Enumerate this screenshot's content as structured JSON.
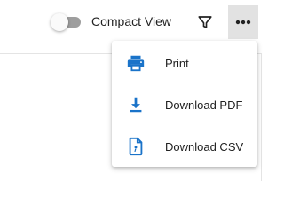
{
  "toolbar": {
    "compact_view": {
      "label": "Compact View",
      "enabled": false
    },
    "filter_icon": "filter-icon",
    "more_icon": "more-horizontal-icon"
  },
  "menu": {
    "items": [
      {
        "label": "Print",
        "icon": "print-icon"
      },
      {
        "label": "Download PDF",
        "icon": "download-icon"
      },
      {
        "label": "Download CSV",
        "icon": "csv-file-icon"
      }
    ]
  },
  "colors": {
    "accent": "#1a73c9",
    "toggle_track": "#9e9e9e",
    "active_button_bg": "#e2e2e2"
  }
}
